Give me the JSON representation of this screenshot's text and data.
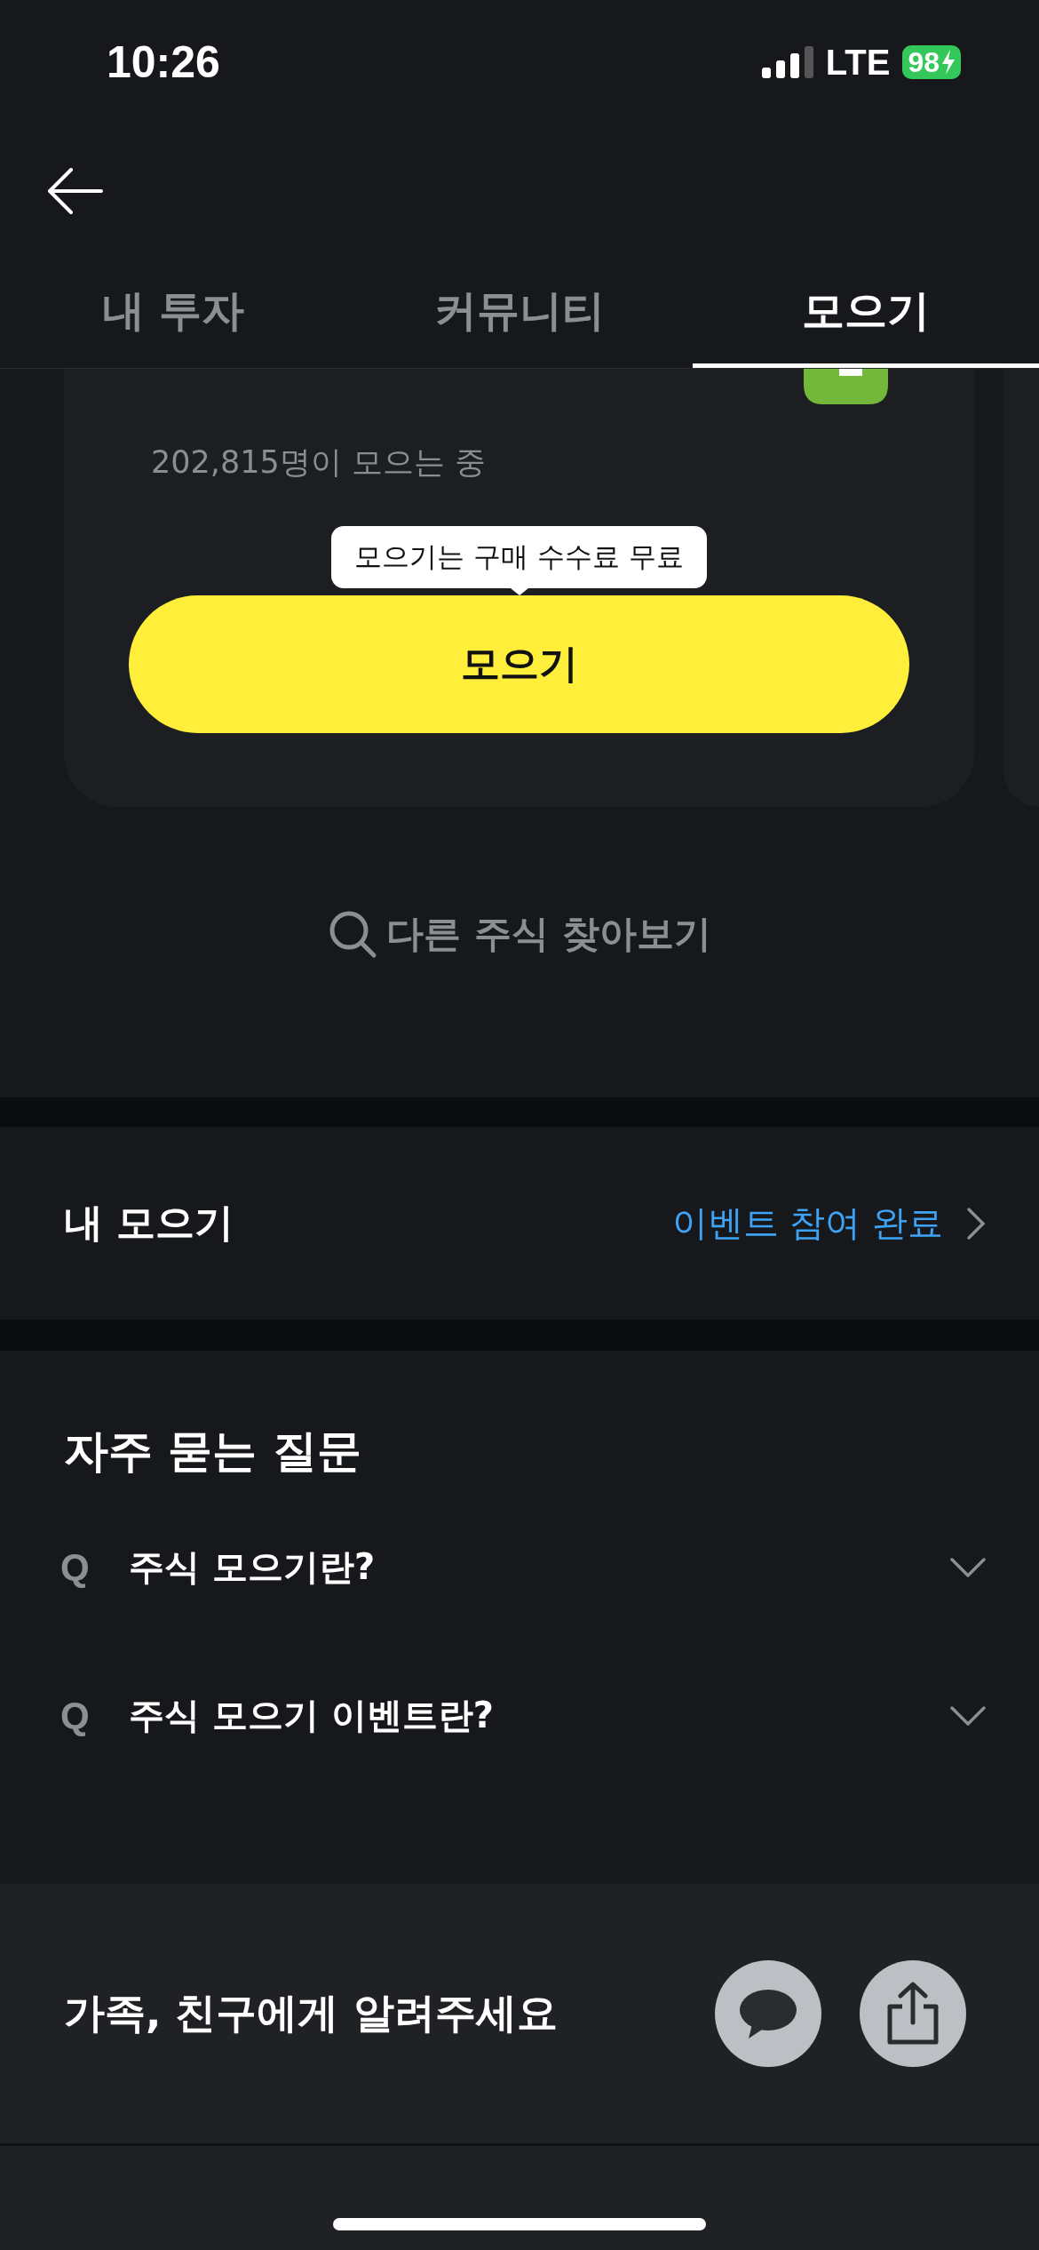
{
  "status_bar": {
    "time": "10:26",
    "network": "LTE",
    "battery": "98"
  },
  "tabs": [
    {
      "label": "내 투자",
      "selected": false
    },
    {
      "label": "커뮤니티",
      "selected": false
    },
    {
      "label": "모으기",
      "selected": true
    }
  ],
  "card": {
    "count": "202,815명이 모으는 중",
    "tooltip": "모으기는 구매 수수료 무료",
    "button": "모으기"
  },
  "search_link": "다른 주식 찾아보기",
  "my_savings": {
    "label": "내 모으기",
    "status": "이벤트 참여 완료"
  },
  "faq": {
    "title": "자주 묻는 질문",
    "items": [
      {
        "marker": "Q",
        "question": "주식 모으기란?",
        "expanded": false
      },
      {
        "marker": "Q",
        "question": "주식 모으기 이벤트란?",
        "expanded": false
      }
    ]
  },
  "share": {
    "text": "가족, 친구에게 알려주세요"
  }
}
